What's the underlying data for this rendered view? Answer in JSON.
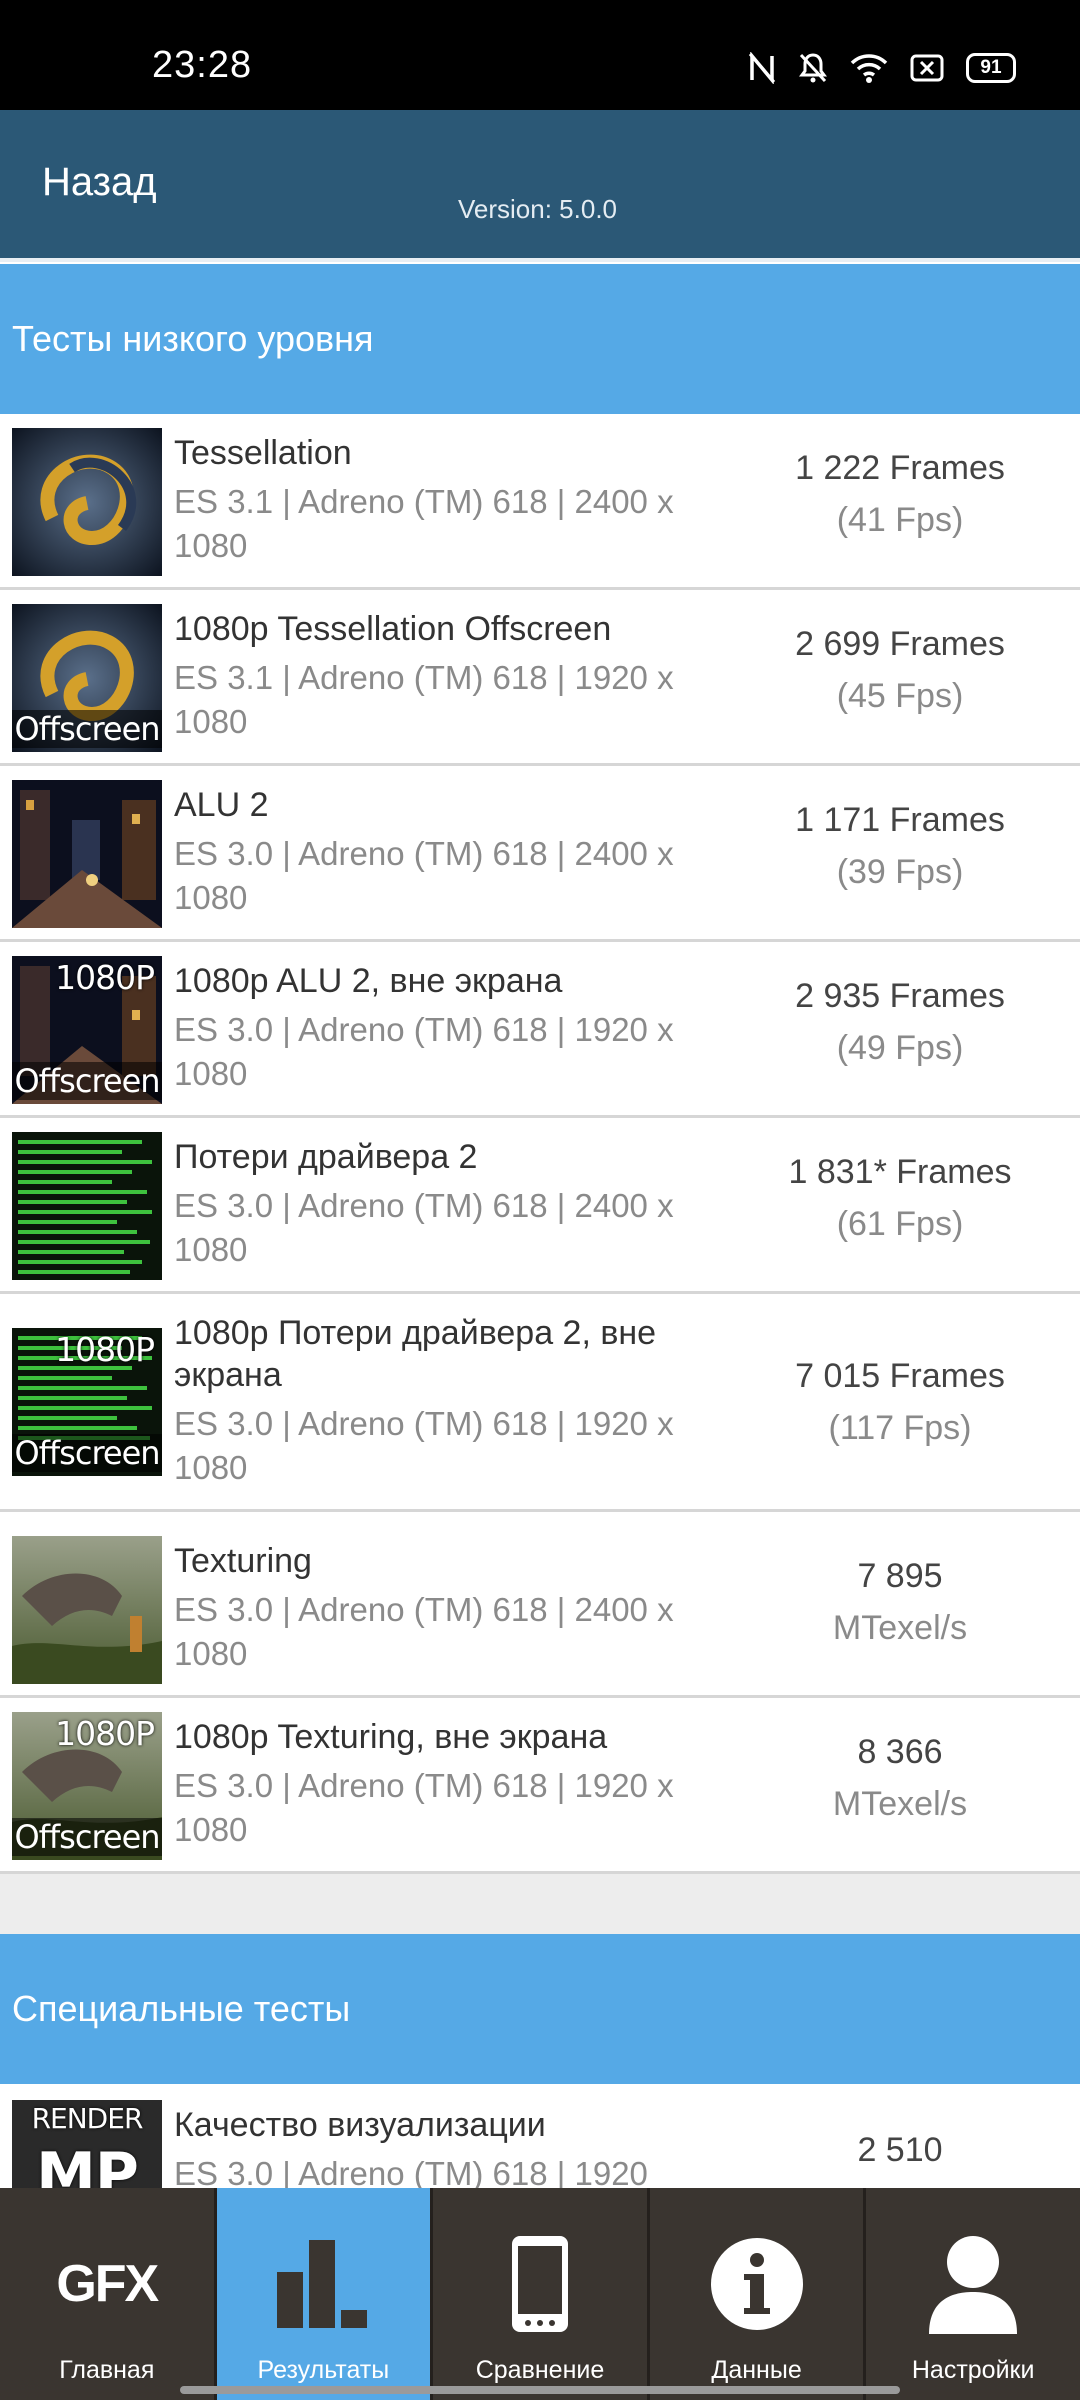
{
  "status_bar": {
    "time": "23:28",
    "battery": "91"
  },
  "header": {
    "back_label": "Назад",
    "version": "Version: 5.0.0"
  },
  "sections": {
    "low_level": "Тесты низкого уровня",
    "special": "Специальные тесты"
  },
  "tests": [
    {
      "title": "Tessellation",
      "sub": "ES 3.1 | Adreno (TM) 618 | 2400 x 1080",
      "r1": "1 222 Frames",
      "r2": "(41 Fps)",
      "thumb_top": "",
      "thumb_bottom": ""
    },
    {
      "title": "1080p Tessellation Offscreen",
      "sub": "ES 3.1 | Adreno (TM) 618 | 1920 x 1080",
      "r1": "2 699 Frames",
      "r2": "(45 Fps)",
      "thumb_top": "",
      "thumb_bottom": "Offscreen"
    },
    {
      "title": "ALU 2",
      "sub": "ES 3.0 | Adreno (TM) 618 | 2400 x 1080",
      "r1": "1 171 Frames",
      "r2": "(39 Fps)",
      "thumb_top": "",
      "thumb_bottom": ""
    },
    {
      "title": "1080p ALU 2, вне экрана",
      "sub": "ES 3.0 | Adreno (TM) 618 | 1920 x 1080",
      "r1": "2 935 Frames",
      "r2": "(49 Fps)",
      "thumb_top": "1080P",
      "thumb_bottom": "Offscreen"
    },
    {
      "title": "Потери драйвера 2",
      "sub": "ES 3.0 | Adreno (TM) 618 | 2400 x 1080",
      "r1": "1 831* Frames",
      "r2": "(61 Fps)",
      "thumb_top": "",
      "thumb_bottom": ""
    },
    {
      "title": "1080p Потери драйвера 2, вне экрана",
      "sub": "ES 3.0 | Adreno (TM) 618 | 1920 x 1080",
      "r1": "7 015 Frames",
      "r2": "(117 Fps)",
      "thumb_top": "1080P",
      "thumb_bottom": "Offscreen"
    },
    {
      "title": "Texturing",
      "sub": "ES 3.0 | Adreno (TM) 618 | 2400 x 1080",
      "r1": "7 895",
      "r2": "MTexel/s",
      "thumb_top": "",
      "thumb_bottom": ""
    },
    {
      "title": "1080p Texturing, вне экрана",
      "sub": "ES 3.0 | Adreno (TM) 618 | 1920 x 1080",
      "r1": "8 366",
      "r2": "MTexel/s",
      "thumb_top": "1080P",
      "thumb_bottom": "Offscreen"
    }
  ],
  "special_tests": [
    {
      "title": "Качество визуализации",
      "sub": "ES 3.0 | Adreno (TM) 618 | 1920",
      "r1": "2 510",
      "thumb_top": "RENDER",
      "thumb_bottom": "MP"
    }
  ],
  "nav": {
    "gfx_logo": "GFX",
    "home": "Главная",
    "results": "Результаты",
    "compare": "Сравнение",
    "data": "Данные",
    "settings": "Настройки"
  },
  "colors": {
    "header": "#2b5876",
    "section": "#55a9e6",
    "nav_bg": "#3a3530",
    "nav_active": "#55a9e6"
  },
  "icons": [
    "nfc-off-icon",
    "bell-muted-icon",
    "wifi-icon",
    "close-box-icon",
    "battery-icon",
    "bar-chart-icon",
    "phone-icon",
    "info-icon",
    "person-icon"
  ]
}
